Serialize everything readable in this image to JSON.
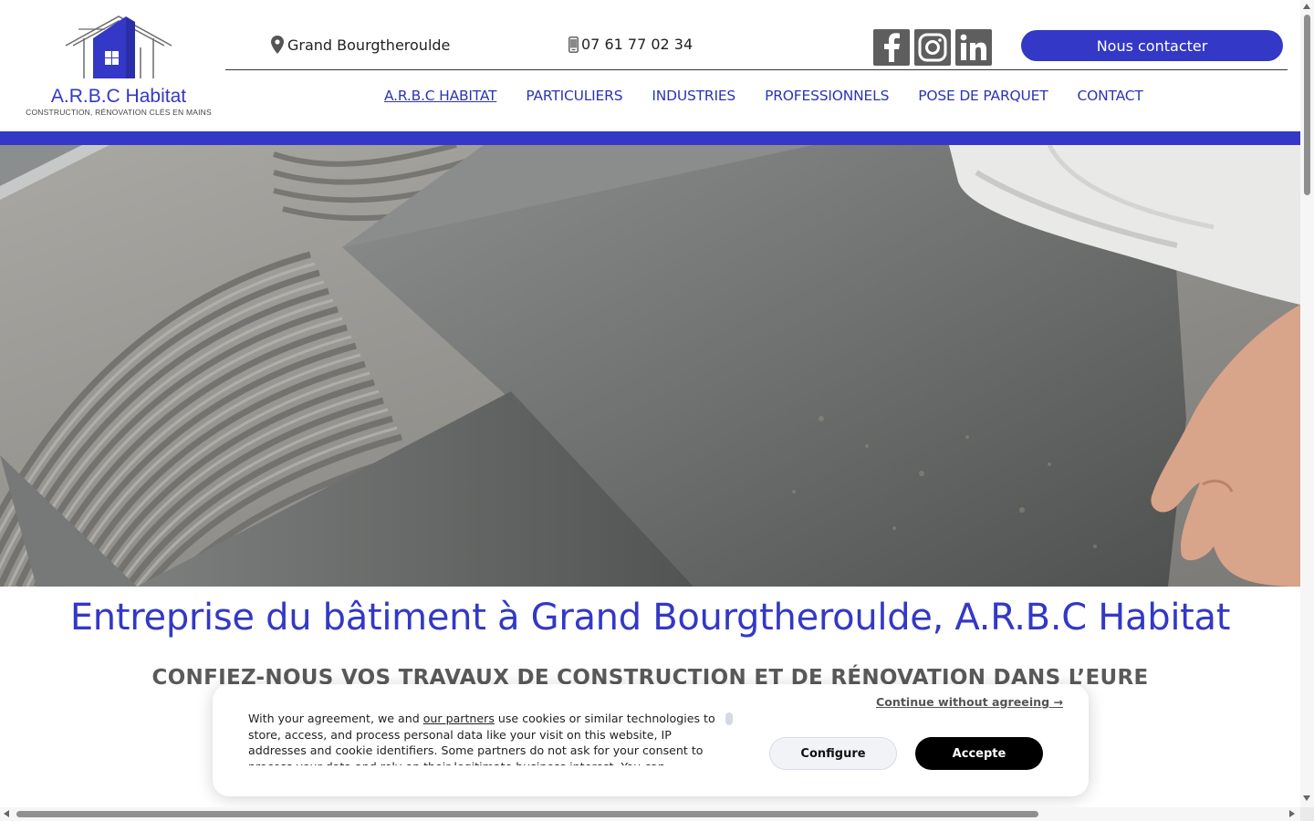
{
  "header": {
    "logo": {
      "title": "A.R.B.C Habitat",
      "subtitle": "CONSTRUCTION, RÉNOVATION CLÉS EN MAINS"
    },
    "location": "Grand Bourgtheroulde",
    "phone": "07 61 77 02 34",
    "socials": [
      {
        "name": "facebook",
        "icon": "facebook-icon"
      },
      {
        "name": "instagram",
        "icon": "instagram-icon"
      },
      {
        "name": "linkedin",
        "icon": "linkedin-icon"
      }
    ],
    "cta_label": "Nous contacter"
  },
  "nav": {
    "items": [
      {
        "label": "A.R.B.C HABITAT",
        "active": true
      },
      {
        "label": "PARTICULIERS",
        "active": false
      },
      {
        "label": "INDUSTRIES",
        "active": false
      },
      {
        "label": "PROFESSIONNELS",
        "active": false
      },
      {
        "label": "POSE DE PARQUET",
        "active": false
      },
      {
        "label": "CONTACT",
        "active": false
      }
    ]
  },
  "main": {
    "title": "Entreprise du bâtiment à Grand Bourgtheroulde, A.R.B.C Habitat",
    "subtitle": "CONFIEZ-NOUS VOS TRAVAUX DE CONSTRUCTION ET DE RÉNOVATION DANS L’EURE"
  },
  "cookie": {
    "text_before": "With your agreement, we and ",
    "partners_link": "our partners",
    "text_after": " use cookies or similar technologies to store, access, and process personal data like your visit on this website, IP addresses and cookie identifiers. Some partners do not ask for your consent to process your data and rely on their legitimate business interest. You can",
    "continue_label": "Continue without agreeing →",
    "configure_label": "Configure",
    "accept_label": "Accepte"
  },
  "colors": {
    "brand_blue": "#3338c6",
    "nav_blue": "#2c35b4",
    "social_gray": "#5e5e5e"
  }
}
